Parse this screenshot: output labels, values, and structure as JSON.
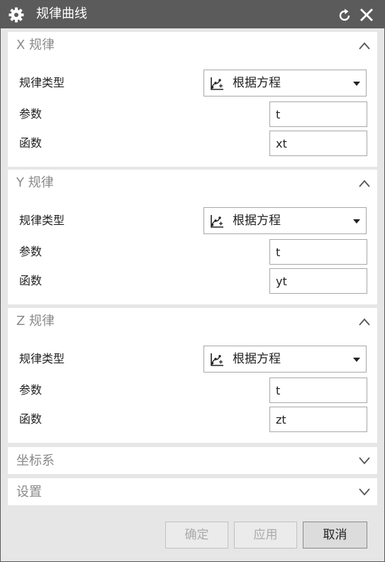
{
  "window": {
    "title": "规律曲线"
  },
  "sections": [
    {
      "title": "X 规律",
      "law_type_label": "规律类型",
      "law_type_value": "根据方程",
      "param_label": "参数",
      "param_value": "t",
      "func_label": "函数",
      "func_value": "xt"
    },
    {
      "title": "Y 规律",
      "law_type_label": "规律类型",
      "law_type_value": "根据方程",
      "param_label": "参数",
      "param_value": "t",
      "func_label": "函数",
      "func_value": "yt"
    },
    {
      "title": "Z 规律",
      "law_type_label": "规律类型",
      "law_type_value": "根据方程",
      "param_label": "参数",
      "param_value": "t",
      "func_label": "函数",
      "func_value": "zt"
    }
  ],
  "coordinate_system": {
    "title": "坐标系"
  },
  "settings": {
    "title": "设置"
  },
  "buttons": {
    "ok": "确定",
    "apply": "应用",
    "cancel": "取消"
  },
  "icons": {
    "title": "gear-icon",
    "reset": "reset-icon",
    "close": "close-icon",
    "law_type": "equation-law-icon",
    "collapse": "chevron-up-icon",
    "expand": "chevron-down-icon"
  }
}
